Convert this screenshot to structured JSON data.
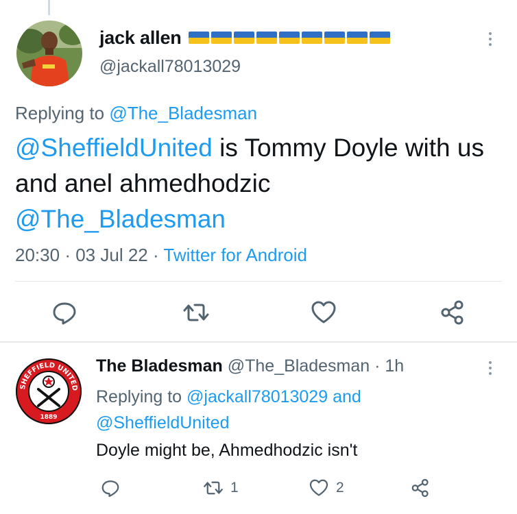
{
  "main_tweet": {
    "display_name": "jack allen",
    "flag_count": 9,
    "flag_colors": [
      "#2f6fc4",
      "#f4c21b"
    ],
    "handle": "@jackall78013029",
    "replying_prefix": "Replying to",
    "replying_to": "@The_Bladesman",
    "text_mention_1": "@SheffieldUnited",
    "text_body": " is Tommy Doyle with us  and anel ahmedhodzic",
    "text_mention_2": "@The_Bladesman",
    "time": "20:30",
    "date": "03 Jul 22",
    "source": "Twitter for Android",
    "icons": [
      "reply-icon",
      "retweet-icon",
      "like-icon",
      "share-icon",
      "more-icon"
    ]
  },
  "reply_tweet": {
    "display_name": "The Bladesman",
    "handle": "@The_Bladesman",
    "age": "1h",
    "replying_prefix": "Replying to",
    "replying_to_1": "@jackall78013029",
    "replying_and": "and",
    "replying_to_2": "@SheffieldUnited",
    "text": "Doyle might be, Ahmedhodzic isn't",
    "retweet_count": "1",
    "like_count": "2",
    "badge_text": "SHEFFIELD UNITED F.C.",
    "badge_year": "1889"
  },
  "colors": {
    "link": "#1d9bf0",
    "secondary_text": "#536471",
    "primary_text": "#0f1419",
    "divider": "#e6e9ec",
    "badge_red": "#d71920"
  }
}
